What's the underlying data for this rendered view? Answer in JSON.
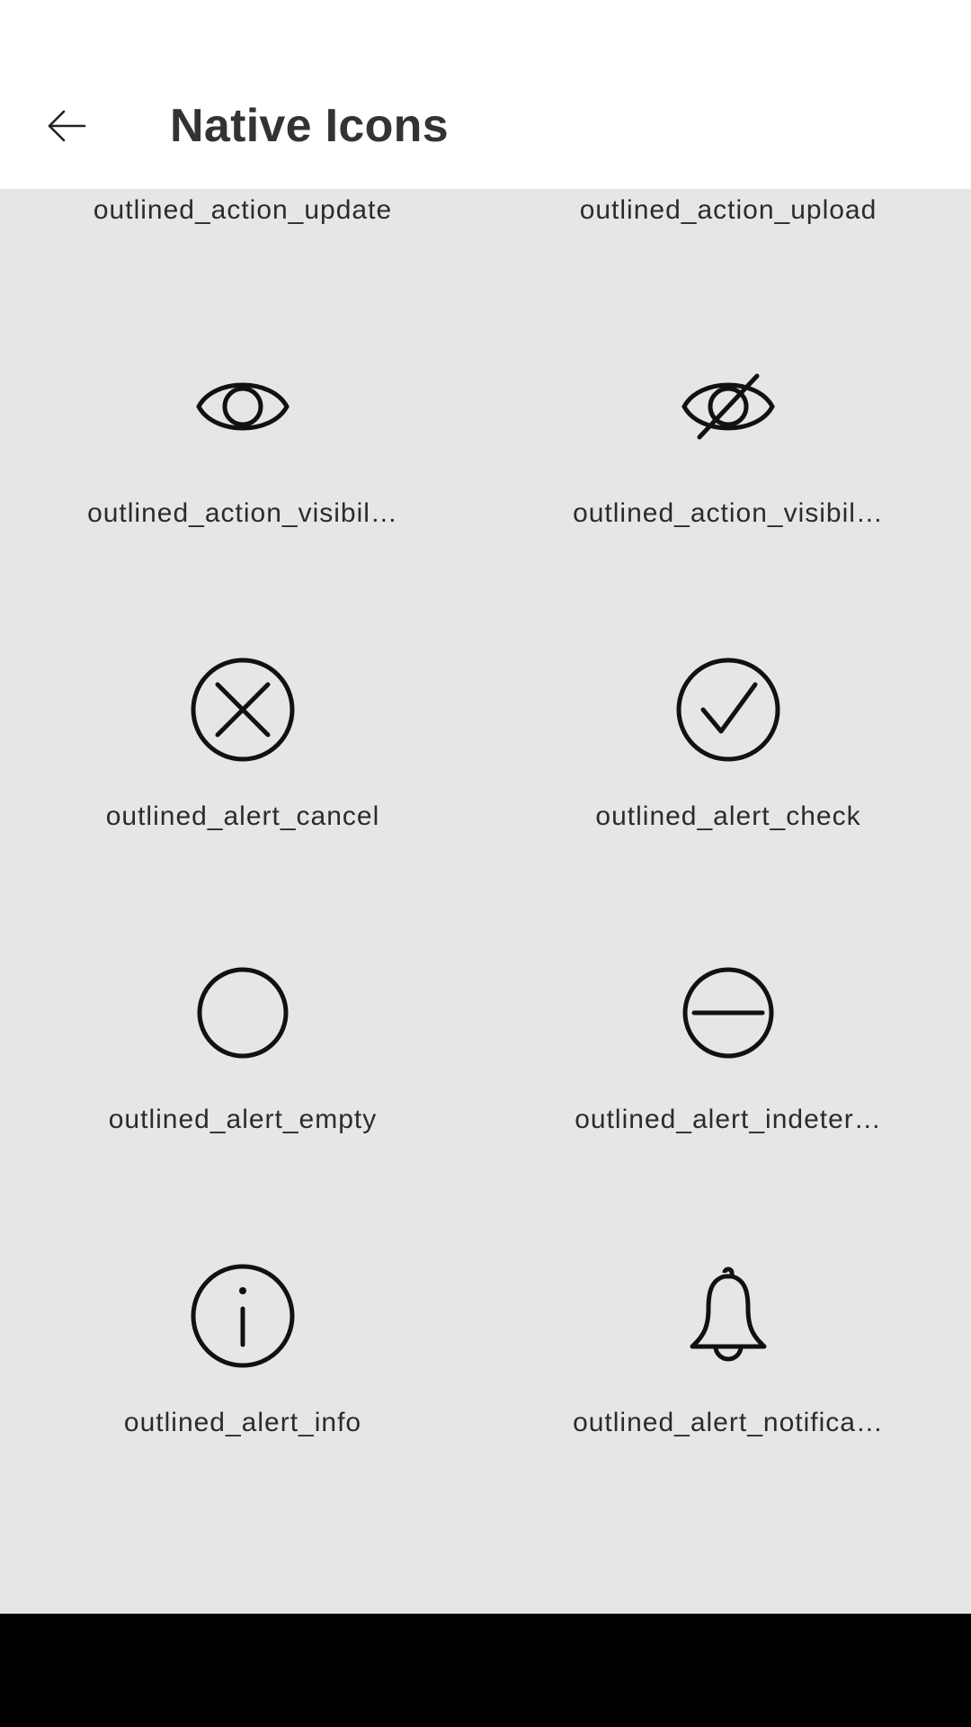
{
  "app_bar": {
    "title": "Native Icons",
    "back_icon": "arrow-left-icon"
  },
  "icons": [
    {
      "label": "outlined_action_update",
      "icon": "update-icon"
    },
    {
      "label": "outlined_action_upload",
      "icon": "upload-icon"
    },
    {
      "label": "outlined_action_visibil…",
      "icon": "eye-icon"
    },
    {
      "label": "outlined_action_visibil…",
      "icon": "eye-off-icon"
    },
    {
      "label": "outlined_alert_cancel",
      "icon": "cancel-circle-icon"
    },
    {
      "label": "outlined_alert_check",
      "icon": "check-circle-icon"
    },
    {
      "label": "outlined_alert_empty",
      "icon": "empty-circle-icon"
    },
    {
      "label": "outlined_alert_indeter…",
      "icon": "indeterminate-circle-icon"
    },
    {
      "label": "outlined_alert_info",
      "icon": "info-circle-icon"
    },
    {
      "label": "outlined_alert_notifica…",
      "icon": "bell-icon"
    }
  ],
  "colors": {
    "background": "#e6e6e6",
    "app_bar": "#ffffff",
    "icon_stroke": "#111111",
    "nav_bar": "#000000"
  }
}
